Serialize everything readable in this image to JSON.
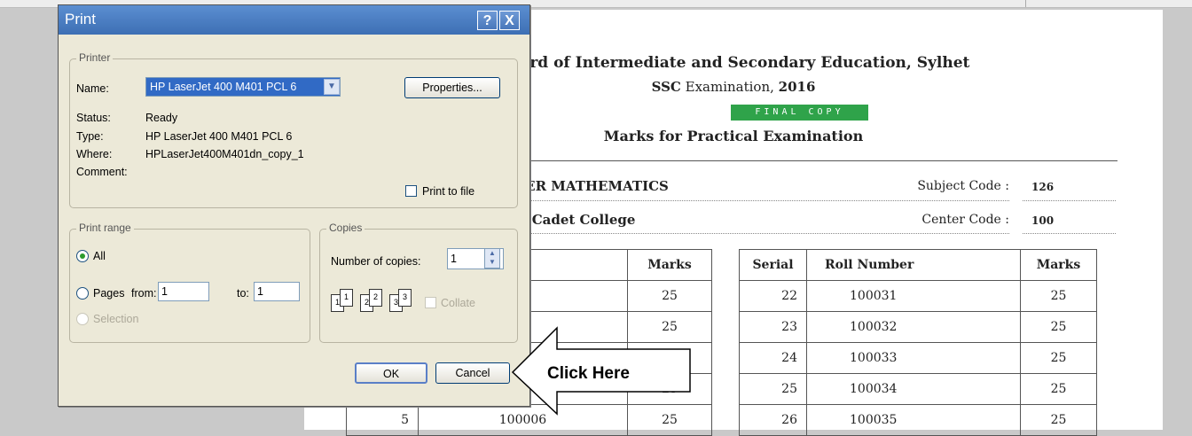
{
  "document": {
    "title": "Board of Intermediate and Secondary Education, Sylhet",
    "exam_prefix": "SSC",
    "exam_middle": " Examination, ",
    "exam_year": "2016",
    "badge": "FINAL COPY",
    "heading": "Marks for Practical Examination",
    "subject_partial": "HER MATHEMATICS",
    "college_partial": "et Cadet College",
    "subject_code_label": "Subject Code :",
    "subject_code": "126",
    "center_code_label": "Center Code :",
    "center_code": "100",
    "left_table": {
      "headers": [
        "er",
        "Marks"
      ],
      "rows": [
        {
          "roll": "",
          "marks": "25"
        },
        {
          "roll": "",
          "marks": "25"
        },
        {
          "roll": "",
          "marks": ""
        },
        {
          "roll": "",
          "marks": "25"
        },
        {
          "serial": "5",
          "roll": "100006",
          "marks": "25"
        }
      ]
    },
    "right_table": {
      "headers": [
        "Serial",
        "Roll Number",
        "Marks"
      ],
      "rows": [
        {
          "serial": "22",
          "roll": "100031",
          "marks": "25"
        },
        {
          "serial": "23",
          "roll": "100032",
          "marks": "25"
        },
        {
          "serial": "24",
          "roll": "100033",
          "marks": "25"
        },
        {
          "serial": "25",
          "roll": "100034",
          "marks": "25"
        },
        {
          "serial": "26",
          "roll": "100035",
          "marks": "25"
        }
      ]
    }
  },
  "dialog": {
    "title": "Print",
    "help_label": "?",
    "close_label": "X",
    "printer_group": "Printer",
    "name_label": "Name:",
    "name_value": "HP LaserJet 400 M401 PCL 6",
    "properties_label": "Properties...",
    "status_label": "Status:",
    "status_value": "Ready",
    "type_label": "Type:",
    "type_value": "HP LaserJet 400 M401 PCL 6",
    "where_label": "Where:",
    "where_value": "HPLaserJet400M401dn_copy_1",
    "comment_label": "Comment:",
    "print_to_file_label": "Print to file",
    "range_group": "Print range",
    "all_label": "All",
    "pages_label": "Pages",
    "from_label": "from:",
    "from_value": "1",
    "to_label": "to:",
    "to_value": "1",
    "selection_label": "Selection",
    "copies_group": "Copies",
    "num_copies_label": "Number of copies:",
    "num_copies_value": "1",
    "collate_label": "Collate",
    "ok_label": "OK",
    "cancel_label": "Cancel"
  },
  "callout": {
    "text": "Click Here"
  }
}
